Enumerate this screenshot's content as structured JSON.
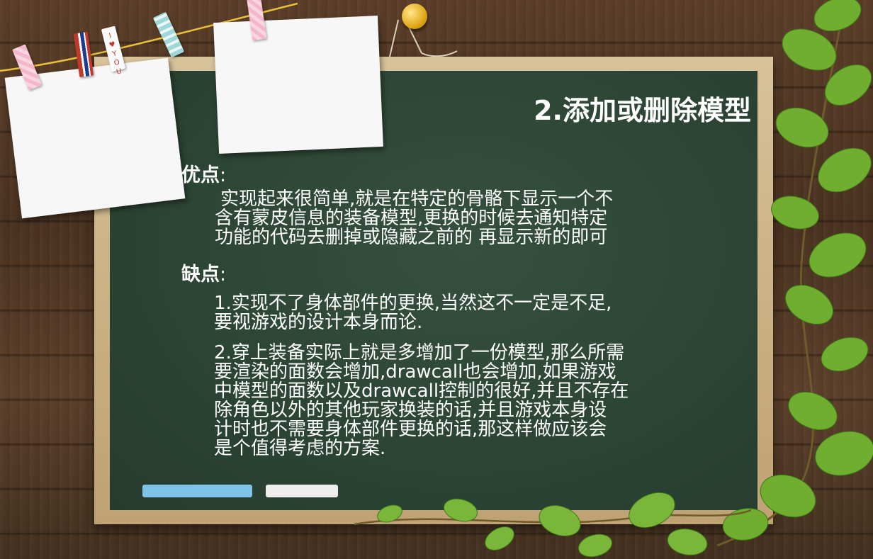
{
  "title": "2.添加或删除模型",
  "pros": {
    "label": "优点",
    "colon": ":",
    "lines": [
      "实现起来很简单,就是在特定的骨骼下显示一个不",
      "含有蒙皮信息的装备模型,更换的时候去通知特定",
      "功能的代码去删掉或隐藏之前的 再显示新的即可"
    ]
  },
  "cons": {
    "label": "缺点",
    "colon": ":",
    "item1": [
      "1.实现不了身体部件的更换,当然这不一定是不足,",
      "要视游戏的设计本身而论."
    ],
    "item2": [
      "2.穿上装备实际上就是多增加了一份模型,那么所需",
      "要渲染的面数会增加,drawcall也会增加,如果游戏",
      "中模型的面数以及drawcall控制的很好,并且不存在",
      "除角色以外的其他玩家换装的话,并且游戏本身设",
      "计时也不需要身体部件更换的话,那这样做应该会",
      "是个值得考虑的方案."
    ]
  },
  "decor": {
    "clip_text": "I ♥ YOU",
    "colors": {
      "board": "#2c4535",
      "frame": "#c9ae80",
      "wood": "#4a3220",
      "chalk_blue": "#7fc3e8",
      "leaf": "#6fae2f"
    }
  }
}
